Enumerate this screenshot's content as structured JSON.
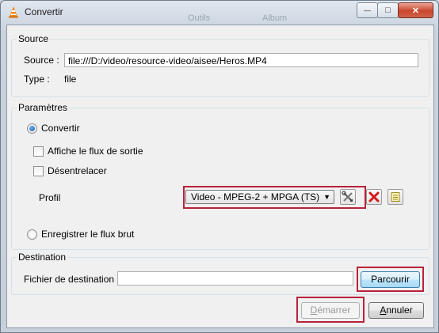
{
  "window": {
    "title": "Convertir",
    "background_menu_items": [
      "Outils",
      "Album"
    ],
    "controls": {
      "minimize": "—",
      "maximize": "□",
      "close": "✕"
    }
  },
  "source": {
    "group_title": "Source",
    "source_label": "Source :",
    "source_value": "file:///D:/video/resource-video/aisee/Heros.MP4",
    "type_label": "Type :",
    "type_value": "file"
  },
  "parameters": {
    "group_title": "Paramètres",
    "convert_label": "Convertir",
    "convert_selected": true,
    "show_output_label": "Affiche le flux de sortie",
    "show_output_checked": false,
    "deinterlace_label": "Désentrelacer",
    "deinterlace_checked": false,
    "profile_label": "Profil",
    "profile_selected": "Video - MPEG-2 + MPGA (TS)",
    "raw_dump_label": "Enregistrer le flux brut",
    "raw_dump_selected": false
  },
  "destination": {
    "group_title": "Destination",
    "file_label": "Fichier de destination :",
    "file_value": "",
    "browse_label": "Parcourir"
  },
  "footer": {
    "start_label_prefix": "",
    "start_label_underlined": "D",
    "start_label_rest": "émarrer",
    "start_enabled": false,
    "cancel_label_underlined": "A",
    "cancel_label_rest": "nnuler"
  },
  "colors": {
    "highlight": "#b9223a",
    "accent": "#1e5fa8"
  }
}
